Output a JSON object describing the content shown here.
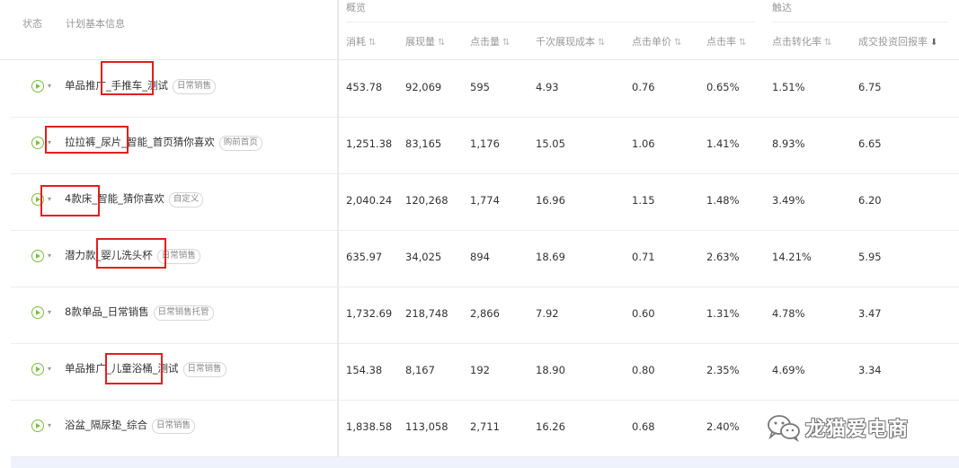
{
  "header": {
    "status": "状态",
    "plan_info": "计划基本信息",
    "group_overview": "概览",
    "group_reach": "触达",
    "columns": [
      "消耗",
      "展现量",
      "点击量",
      "千次展现成本",
      "点击单价",
      "点击率",
      "点击转化率",
      "成交投资回报率"
    ],
    "sort_icon": "⇅",
    "sort_active_icon": "⬇"
  },
  "rows": [
    {
      "name": "单品推广_手推车_测试",
      "tag": "日常销售",
      "values": [
        "453.78",
        "92,069",
        "595",
        "4.93",
        "0.76",
        "0.65%",
        "1.51%",
        "6.75"
      ]
    },
    {
      "name": "拉拉裤_尿片_智能_首页猜你喜欢",
      "tag": "购前首页",
      "values": [
        "1,251.38",
        "83,165",
        "1,176",
        "15.05",
        "1.06",
        "1.41%",
        "8.93%",
        "6.65"
      ]
    },
    {
      "name": "4款床_智能_猜你喜欢",
      "tag": "自定义",
      "values": [
        "2,040.24",
        "120,268",
        "1,774",
        "16.96",
        "1.15",
        "1.48%",
        "3.49%",
        "6.20"
      ]
    },
    {
      "name": "潜力款_婴儿洗头杯",
      "tag": "日常销售",
      "values": [
        "635.97",
        "34,025",
        "894",
        "18.69",
        "0.71",
        "2.63%",
        "14.21%",
        "5.95"
      ]
    },
    {
      "name": "8款单品_日常销售",
      "tag": "日常销售托管",
      "values": [
        "1,732.69",
        "218,748",
        "2,866",
        "7.92",
        "0.60",
        "1.31%",
        "4.78%",
        "3.47"
      ]
    },
    {
      "name": "单品推广_儿童浴桶_测试",
      "tag": "日常销售",
      "values": [
        "154.38",
        "8,167",
        "192",
        "18.90",
        "0.80",
        "2.35%",
        "4.69%",
        "3.34"
      ]
    },
    {
      "name": "浴盆_隔尿垫_综合",
      "tag": "日常销售",
      "values": [
        "1,838.58",
        "113,058",
        "2,711",
        "16.26",
        "0.68",
        "2.40%",
        "",
        ""
      ]
    }
  ],
  "watermark": {
    "text": "龙猫爱电商",
    "icon": "wechat-icon"
  },
  "colors": {
    "play": "#7cbd3f",
    "highlight": "#e21e1e",
    "footer": "#eef3fb"
  }
}
